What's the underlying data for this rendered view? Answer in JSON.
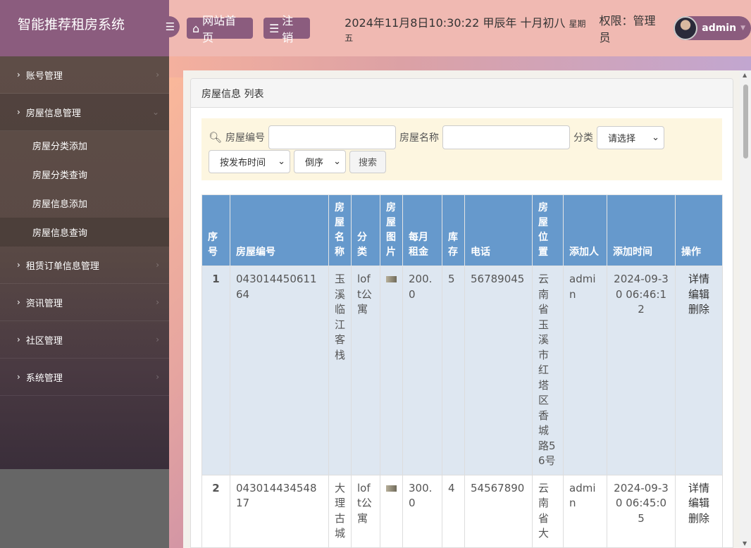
{
  "app": {
    "title": "智能推荐租房系统"
  },
  "header": {
    "home": "网站首页",
    "logout": "注销",
    "datetime": "2024年11月8日10:30:22 甲辰年 十月初八",
    "weekday": "星期五",
    "permission": "权限：管理员",
    "user": "admin"
  },
  "sidebar": {
    "items": [
      {
        "label": "账号管理"
      },
      {
        "label": "房屋信息管理",
        "children": [
          {
            "label": "房屋分类添加"
          },
          {
            "label": "房屋分类查询"
          },
          {
            "label": "房屋信息添加"
          },
          {
            "label": "房屋信息查询"
          }
        ]
      },
      {
        "label": "租赁订单信息管理"
      },
      {
        "label": "资讯管理"
      },
      {
        "label": "社区管理"
      },
      {
        "label": "系统管理"
      }
    ]
  },
  "panel": {
    "title": "房屋信息 列表"
  },
  "search": {
    "code_label": "房屋编号",
    "name_label": "房屋名称",
    "category_label": "分类",
    "category_value": "请选择",
    "sort_value": "按发布时间",
    "order_value": "倒序",
    "button": "搜索"
  },
  "table": {
    "headers": [
      "序号",
      "房屋编号",
      "房屋名称",
      "分类",
      "房屋图片",
      "每月租金",
      "库存",
      "电话",
      "房屋位置",
      "添加人",
      "添加时间",
      "操作"
    ],
    "rows": [
      {
        "no": "1",
        "code": "04301445061164",
        "name": "玉溪临江客栈",
        "category": "loft公寓",
        "rent": "200.0",
        "stock": "5",
        "phone": "56789045",
        "location": "云南省玉溪市红塔区香城路56号",
        "adder": "admin",
        "time": "2024-09-30 06:46:12",
        "detail": "详情",
        "edit": "编辑",
        "delete": "删除"
      },
      {
        "no": "2",
        "code": "04301443454817",
        "name": "大理古城",
        "category": "loft公寓",
        "rent": "300.0",
        "stock": "4",
        "phone": "54567890",
        "location": "云南省大",
        "adder": "admin",
        "time": "2024-09-30 06:45:05",
        "detail": "详情",
        "edit": "编辑",
        "delete": "删除"
      }
    ]
  }
}
